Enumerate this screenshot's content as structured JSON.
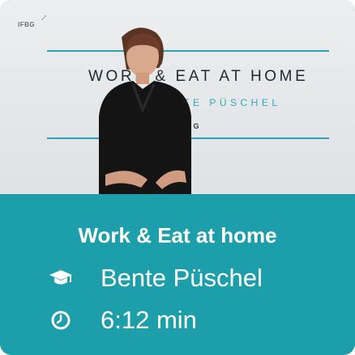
{
  "thumbnail": {
    "brand_logo": "IFBG",
    "video_title": "WORK & EAT AT HOME",
    "video_speaker": "BENTE PÜSCHEL",
    "video_logo": "IFBG"
  },
  "card": {
    "title": "Work & Eat at home",
    "instructor": "Bente Püschel",
    "duration": "6:12 min",
    "instructor_icon": "graduation-cap-icon",
    "duration_icon": "clock-icon"
  },
  "colors": {
    "accent": "#1d9eab",
    "line": "#2aa2b6",
    "text_on_accent": "#ffffff"
  }
}
